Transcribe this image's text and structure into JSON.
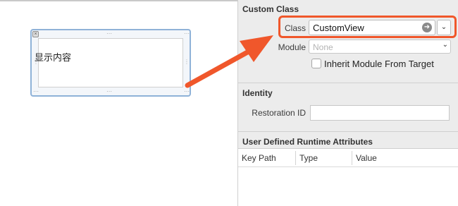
{
  "canvas": {
    "view_label": "显示内容"
  },
  "inspector": {
    "custom_class": {
      "title": "Custom Class",
      "class_label": "Class",
      "class_value": "CustomView",
      "module_label": "Module",
      "module_placeholder": "None",
      "inherit_label": "Inherit Module From Target",
      "inherit_checked": false
    },
    "identity": {
      "title": "Identity",
      "restoration_label": "Restoration ID",
      "restoration_value": ""
    },
    "runtime_attributes": {
      "title": "User Defined Runtime Attributes",
      "columns": [
        "Key Path",
        "Type",
        "Value"
      ]
    }
  },
  "colors": {
    "highlight": "#f0572b",
    "view_border": "#8fb2d8"
  },
  "icons": {
    "go": "arrow-right-circle-icon",
    "dropdown": "chevron-down-icon",
    "close": "close-icon"
  }
}
